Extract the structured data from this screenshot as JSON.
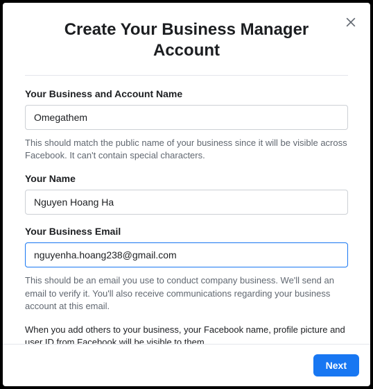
{
  "modal": {
    "title": "Create Your Business Manager Account",
    "fields": {
      "business_name": {
        "label": "Your Business and Account Name",
        "value": "Omegathem",
        "helper": "This should match the public name of your business since it will be visible across Facebook. It can't contain special characters."
      },
      "your_name": {
        "label": "Your Name",
        "value": "Nguyen Hoang Ha"
      },
      "business_email": {
        "label": "Your Business Email",
        "value": "nguyenha.hoang238@gmail.com",
        "helper": "This should be an email you use to conduct company business. We'll send an email to verify it. You'll also receive communications regarding your business account at this email."
      }
    },
    "info": "When you add others to your business, your Facebook name, profile picture and user ID from Facebook will be visible to them.",
    "next_label": "Next"
  }
}
